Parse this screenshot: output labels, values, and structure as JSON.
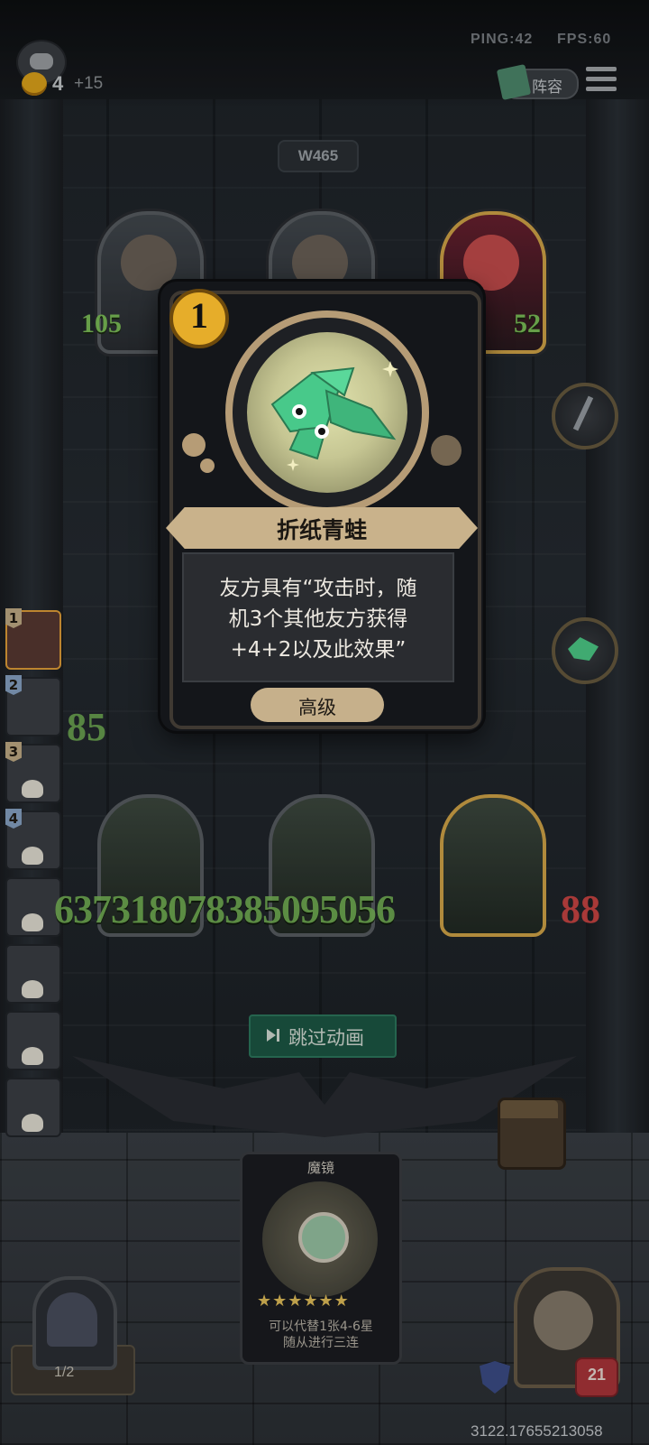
{
  "status": {
    "ping": "PING:42",
    "fps": "FPS:60"
  },
  "player": {
    "gold": "4",
    "gold_bonus": "+15"
  },
  "header": {
    "lineup_label": "阵容",
    "wave": "W465"
  },
  "enemy": {
    "left_stat": "105",
    "right_stat": "52"
  },
  "ranks": [
    {
      "num": "1"
    },
    {
      "num": "2"
    },
    {
      "num": "3"
    },
    {
      "num": "4"
    }
  ],
  "damage": {
    "row_top": "85",
    "row_bottom": "637318078385095056",
    "row_bottom_red": "88"
  },
  "skip": {
    "label": "跳过动画"
  },
  "popup_card": {
    "tier": "1",
    "name": "折纸青蛙",
    "description_lines": [
      "友方具有“攻击时，随",
      "机3个其他友方获得",
      "+4+2以及此效果”"
    ],
    "tag": "高级",
    "icon": "origami-frog-icon",
    "accent_color": "#c9b28b"
  },
  "hand_card": {
    "title": "魔镜",
    "stars": "★★★★★★",
    "desc_line1": "可以代替1张4-6星",
    "desc_line2": "随从进行三连"
  },
  "deck": {
    "count": "1/2"
  },
  "hero": {
    "health": "21"
  },
  "footer": {
    "coords": "3122.17655213058"
  }
}
